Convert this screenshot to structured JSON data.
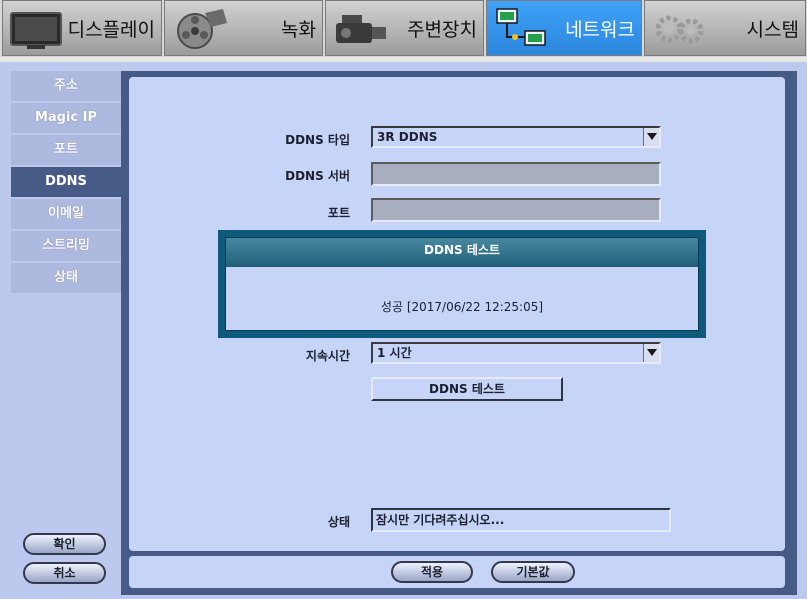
{
  "top_tabs": [
    {
      "label": "디스플레이",
      "icon": "monitor-icon",
      "active": false
    },
    {
      "label": "녹화",
      "icon": "film-reel-icon",
      "active": false
    },
    {
      "label": "주변장치",
      "icon": "camcorder-icon",
      "active": false
    },
    {
      "label": "네트워크",
      "icon": "network-icon",
      "active": true
    },
    {
      "label": "시스템",
      "icon": "gears-icon",
      "active": false
    }
  ],
  "side_menu": [
    {
      "label": "주소",
      "active": false
    },
    {
      "label": "Magic IP",
      "active": false
    },
    {
      "label": "포트",
      "active": false
    },
    {
      "label": "DDNS",
      "active": true
    },
    {
      "label": "이메일",
      "active": false
    },
    {
      "label": "스트리밍",
      "active": false
    },
    {
      "label": "상태",
      "active": false
    }
  ],
  "form": {
    "ddns_type_label": "DDNS 타입",
    "ddns_type_value": "3R DDNS",
    "ddns_server_label": "DDNS 서버",
    "port_label": "포트",
    "duration_label": "지속시간",
    "duration_value": "1 시간",
    "ddns_test_button": "DDNS 테스트",
    "status_label": "상태",
    "status_value": "잠시만 기다려주십시오..."
  },
  "dialog": {
    "title": "DDNS 테스트",
    "message": "성공 [2017/06/22 12:25:05]"
  },
  "footer": {
    "apply_button": "적용",
    "default_button": "기본값"
  },
  "left_buttons": {
    "ok_button": "확인",
    "cancel_button": "취소"
  },
  "colors": {
    "active_tab": "#3399ee",
    "panel": "#c6d4f7",
    "frame": "#465a86",
    "side_active": "#465a86",
    "dialog_border": "#0f5a7a"
  }
}
